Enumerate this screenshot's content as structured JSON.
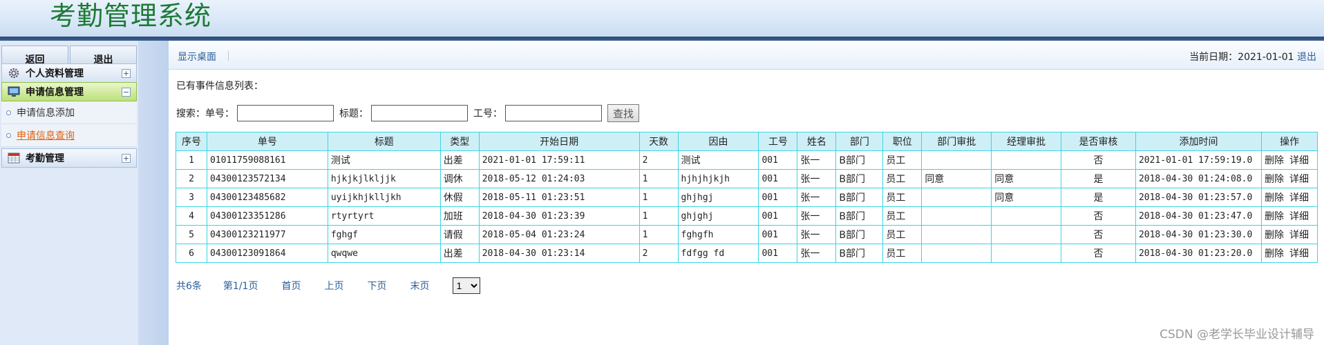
{
  "header": {
    "title": "考勤管理系统"
  },
  "sidebar": {
    "buttons": {
      "back": "返回",
      "logout": "退出"
    },
    "menus": [
      {
        "label": "个人资料管理",
        "toggle": "+"
      },
      {
        "label": "申请信息管理",
        "toggle": "−"
      },
      {
        "label": "考勤管理",
        "toggle": "+"
      }
    ],
    "submenu": [
      "申请信息添加",
      "申请信息查询"
    ]
  },
  "topbar": {
    "desktop_link": "显示桌面",
    "date_label": "当前日期：",
    "date_value": "2021-01-01",
    "logout_link": "退出"
  },
  "list": {
    "title": "已有事件信息列表："
  },
  "search": {
    "prefix": "搜索：",
    "order_label": "单号：",
    "title_label": "标题：",
    "worker_label": "工号：",
    "button": "查找"
  },
  "table": {
    "headers": [
      "序号",
      "单号",
      "标题",
      "类型",
      "开始日期",
      "天数",
      "因由",
      "工号",
      "姓名",
      "部门",
      "职位",
      "部门审批",
      "经理审批",
      "是否审核",
      "添加时间",
      "操作"
    ],
    "rows": [
      [
        "1",
        "01011759088161",
        "测试",
        "出差",
        "2021-01-01 17:59:11",
        "2",
        "测试",
        "001",
        "张一",
        "B部门",
        "员工",
        "",
        "",
        "否",
        "2021-01-01 17:59:19.0"
      ],
      [
        "2",
        "04300123572134",
        "hjkjkjlkljjk",
        "调休",
        "2018-05-12 01:24:03",
        "1",
        "hjhjhjkjh",
        "001",
        "张一",
        "B部门",
        "员工",
        "同意",
        "同意",
        "是",
        "2018-04-30 01:24:08.0"
      ],
      [
        "3",
        "04300123485682",
        "uyijkhjklljkh",
        "休假",
        "2018-05-11 01:23:51",
        "1",
        "ghjhgj",
        "001",
        "张一",
        "B部门",
        "员工",
        "",
        "同意",
        "是",
        "2018-04-30 01:23:57.0"
      ],
      [
        "4",
        "04300123351286",
        "rtyrtyrt",
        "加班",
        "2018-04-30 01:23:39",
        "1",
        "ghjghj",
        "001",
        "张一",
        "B部门",
        "员工",
        "",
        "",
        "否",
        "2018-04-30 01:23:47.0"
      ],
      [
        "5",
        "04300123211977",
        "fghgf",
        "请假",
        "2018-05-04 01:23:24",
        "1",
        "fghgfh",
        "001",
        "张一",
        "B部门",
        "员工",
        "",
        "",
        "否",
        "2018-04-30 01:23:30.0"
      ],
      [
        "6",
        "04300123091864",
        "qwqwe",
        "出差",
        "2018-04-30 01:23:14",
        "2",
        "fdfgg fd",
        "001",
        "张一",
        "B部门",
        "员工",
        "",
        "",
        "否",
        "2018-04-30 01:23:20.0"
      ]
    ],
    "ops": {
      "delete": "删除",
      "detail": "详细"
    }
  },
  "pager": {
    "total": "共6条",
    "page": "第1/1页",
    "first": "首页",
    "prev": "上页",
    "next": "下页",
    "last": "末页",
    "select_value": "1"
  },
  "watermark": "CSDN @老学长毕业设计辅导"
}
